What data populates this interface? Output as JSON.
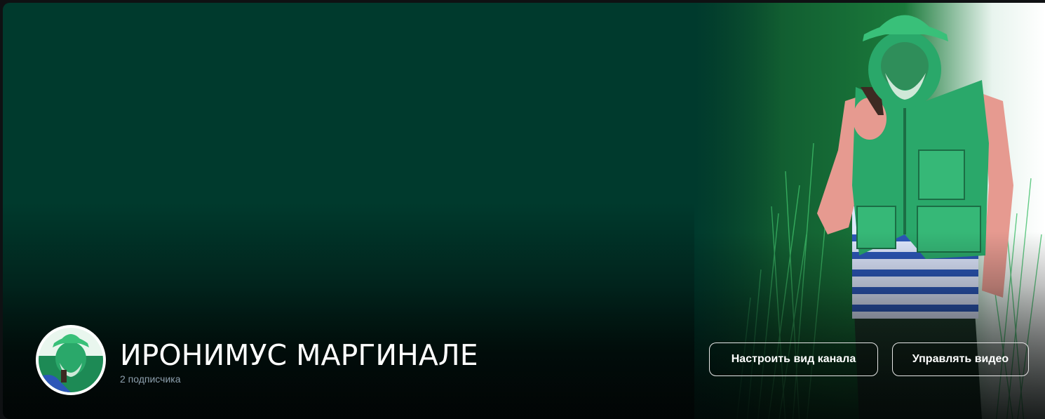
{
  "channel": {
    "name": "ИРОНИМУС МАРГИНАЛЕ",
    "subscribers": "2 подписчика"
  },
  "actions": {
    "customize_label": "Настроить вид канала",
    "manage_label": "Управлять видео"
  },
  "colors": {
    "banner_base": "#003a2d",
    "banner_bottom": "#020807",
    "photo_vest": "#2aa86a",
    "button_border": "#e6e6e6",
    "subscribers_text": "#8ea0ae"
  },
  "icons": {
    "avatar": "avatar-image",
    "cover": "cover-photo-man-with-pipe"
  }
}
